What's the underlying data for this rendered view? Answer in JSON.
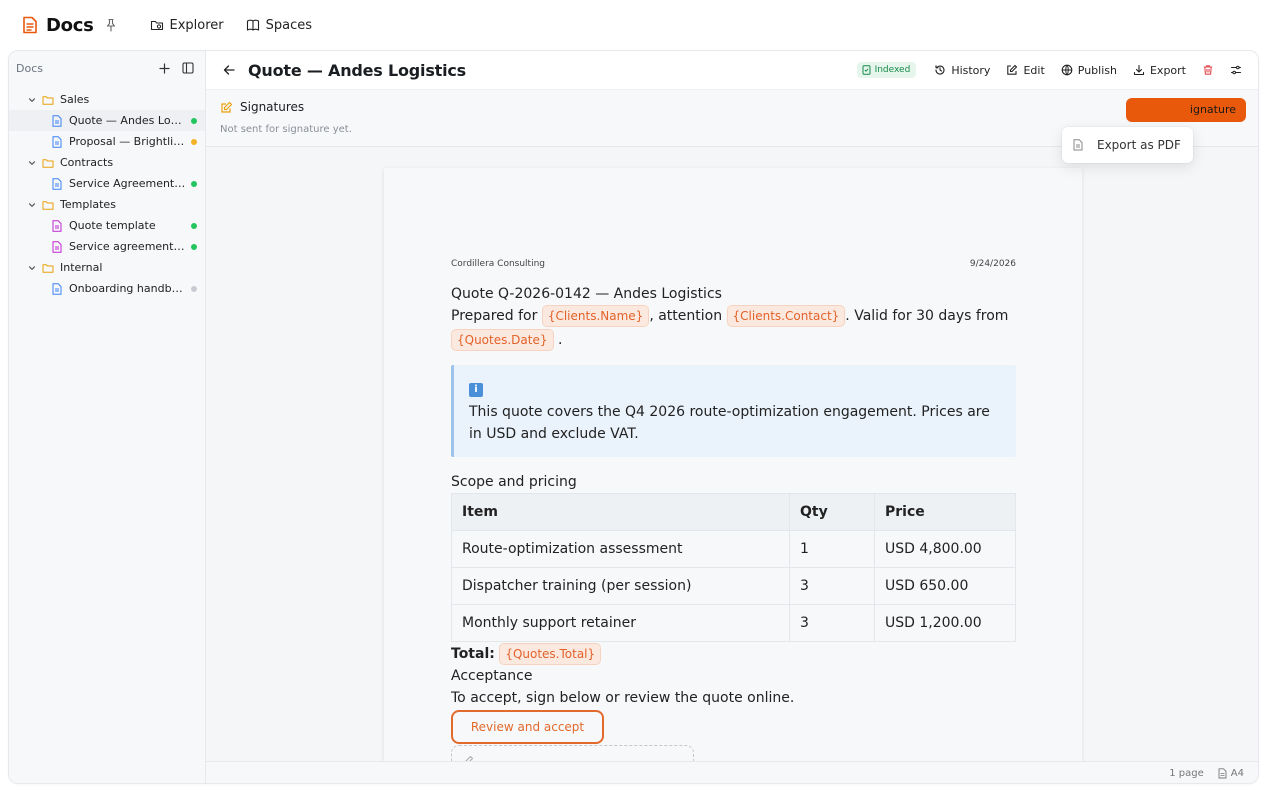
{
  "app": {
    "title": "Docs",
    "nav": [
      {
        "label": "Explorer",
        "icon": "folder-search-icon"
      },
      {
        "label": "Spaces",
        "icon": "book-icon"
      }
    ]
  },
  "sidebar": {
    "title": "Docs",
    "tree": [
      {
        "type": "folder",
        "label": "Sales",
        "expanded": true
      },
      {
        "type": "file",
        "label": "Quote — Andes Logistics",
        "status_color": "#22c55e",
        "icon_color": "#3b82f6",
        "selected": true
      },
      {
        "type": "file",
        "label": "Proposal — Brightline Media",
        "status_color": "#f5b324",
        "icon_color": "#3b82f6"
      },
      {
        "type": "folder",
        "label": "Contracts",
        "expanded": true
      },
      {
        "type": "file",
        "label": "Service Agreement — Andes",
        "status_color": "#22c55e",
        "icon_color": "#3b82f6"
      },
      {
        "type": "folder",
        "label": "Templates",
        "expanded": true
      },
      {
        "type": "file",
        "label": "Quote template",
        "status_color": "#22c55e",
        "icon_color": "#c026d3"
      },
      {
        "type": "file",
        "label": "Service agreement template",
        "status_color": "#22c55e",
        "icon_color": "#c026d3"
      },
      {
        "type": "folder",
        "label": "Internal",
        "expanded": true
      },
      {
        "type": "file",
        "label": "Onboarding handbook",
        "status_color": "#c8ccd2",
        "icon_color": "#3b82f6"
      }
    ]
  },
  "header": {
    "title": "Quote — Andes Logistics",
    "badge": "Indexed",
    "actions": {
      "history": "History",
      "edit": "Edit",
      "publish": "Publish",
      "export": "Export"
    }
  },
  "signatures": {
    "title": "Signatures",
    "subtitle": "Not sent for signature yet.",
    "button_fragment": "ignature"
  },
  "export_menu": {
    "item": "Export as PDF"
  },
  "document": {
    "company": "Cordillera Consulting",
    "date": "9/24/2026",
    "heading": "Quote Q-2026-0142 — Andes Logistics",
    "prepared_for": "Prepared for",
    "var_client_name": "{Clients.Name}",
    "attention": ", attention",
    "var_client_contact": "{Clients.Contact}",
    "valid_text": ". Valid for 30 days from",
    "var_quote_date": "{Quotes.Date}",
    "period": ".",
    "callout_icon": "i",
    "callout_text": "This quote covers the Q4 2026 route-optimization engagement. Prices are in USD and exclude VAT.",
    "scope_heading": "Scope and pricing",
    "table": {
      "headers": [
        "Item",
        "Qty",
        "Price"
      ],
      "rows": [
        [
          "Route-optimization assessment",
          "1",
          "USD 4,800.00"
        ],
        [
          "Dispatcher training (per session)",
          "3",
          "USD 650.00"
        ],
        [
          "Monthly support retainer",
          "3",
          "USD 1,200.00"
        ]
      ]
    },
    "total_label": "Total:",
    "var_quote_total": "{Quotes.Total}",
    "acceptance_heading": "Acceptance",
    "acceptance_text": "To accept, sign below or review the quote online.",
    "accept_button": "Review and accept"
  },
  "footer": {
    "pages": "1 page",
    "page_size": "A4"
  },
  "colors": {
    "accent": "#e8590c",
    "sidebar_bg": "#f7f8fa",
    "callout_bg": "#eaf3fc"
  }
}
